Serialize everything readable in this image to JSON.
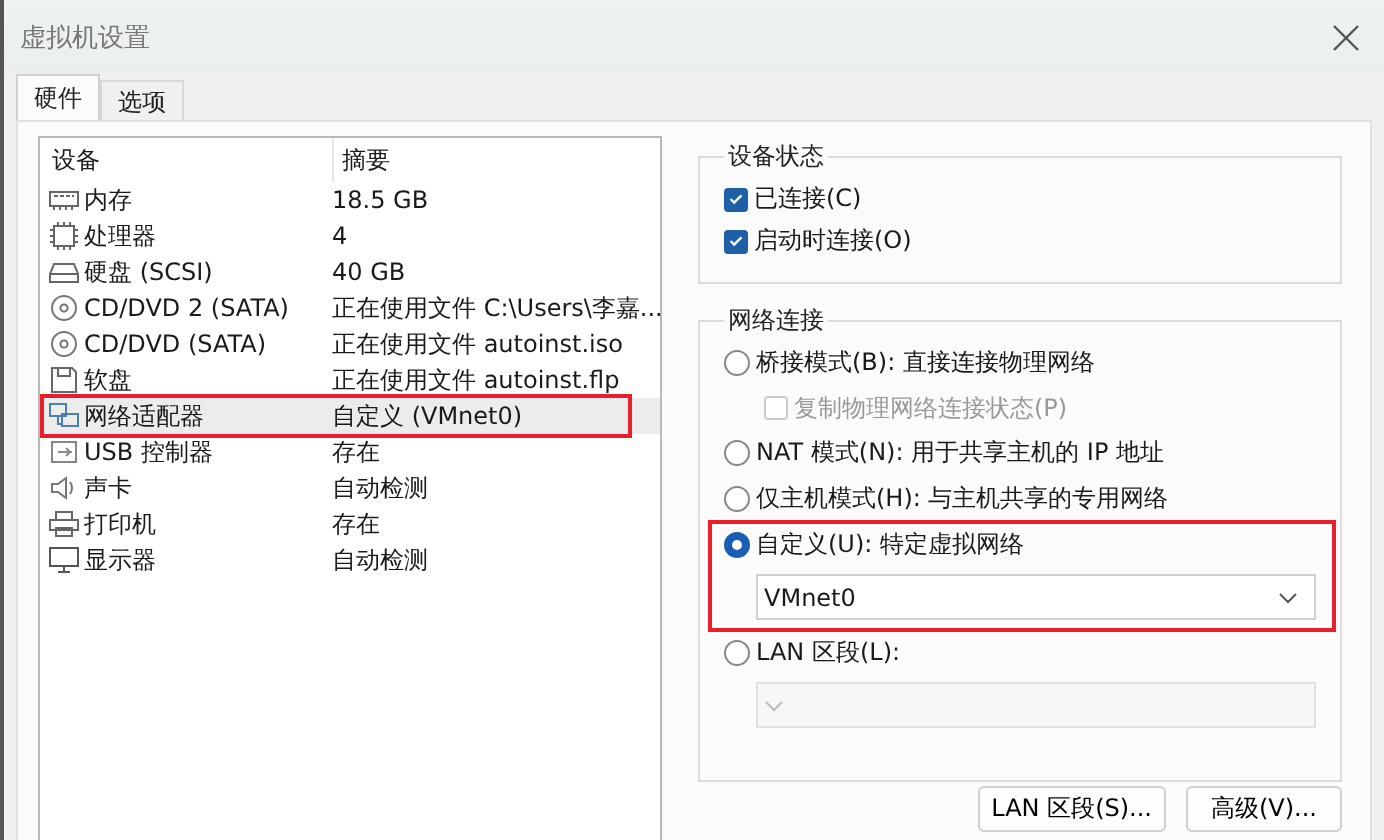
{
  "window": {
    "title": "虚拟机设置"
  },
  "tabs": [
    {
      "label": "硬件",
      "selected": true
    },
    {
      "label": "选项",
      "selected": false
    }
  ],
  "device_list": {
    "columns": [
      "设备",
      "摘要"
    ],
    "rows": [
      {
        "kind": "memory",
        "device": "内存",
        "summary": "18.5 GB",
        "selected": false,
        "highlighted": false
      },
      {
        "kind": "cpu",
        "device": "处理器",
        "summary": "4",
        "selected": false,
        "highlighted": false
      },
      {
        "kind": "disk",
        "device": "硬盘 (SCSI)",
        "summary": "40 GB",
        "selected": false,
        "highlighted": false
      },
      {
        "kind": "cd",
        "device": "CD/DVD 2 (SATA)",
        "summary": "正在使用文件 C:\\Users\\李嘉...",
        "selected": false,
        "highlighted": false
      },
      {
        "kind": "cd",
        "device": "CD/DVD (SATA)",
        "summary": "正在使用文件 autoinst.iso",
        "selected": false,
        "highlighted": false
      },
      {
        "kind": "floppy",
        "device": "软盘",
        "summary": "正在使用文件 autoinst.flp",
        "selected": false,
        "highlighted": false
      },
      {
        "kind": "network",
        "device": "网络适配器",
        "summary": "自定义 (VMnet0)",
        "selected": true,
        "highlighted": true
      },
      {
        "kind": "usb",
        "device": "USB 控制器",
        "summary": "存在",
        "selected": false,
        "highlighted": false
      },
      {
        "kind": "sound",
        "device": "声卡",
        "summary": "自动检测",
        "selected": false,
        "highlighted": false
      },
      {
        "kind": "printer",
        "device": "打印机",
        "summary": "存在",
        "selected": false,
        "highlighted": false
      },
      {
        "kind": "display",
        "device": "显示器",
        "summary": "自动检测",
        "selected": false,
        "highlighted": false
      }
    ]
  },
  "device_status": {
    "title": "设备状态",
    "options": [
      {
        "label": "已连接(C)",
        "checked": true
      },
      {
        "label": "启动时连接(O)",
        "checked": true
      }
    ]
  },
  "network_connection": {
    "title": "网络连接",
    "options": [
      {
        "kind": "radio",
        "label": "桥接模式(B): 直接连接物理网络",
        "selected": false,
        "highlighted": false
      },
      {
        "kind": "checkbox",
        "label": "复制物理网络连接状态(P)",
        "checked": false,
        "disabled": true
      },
      {
        "kind": "radio",
        "label": "NAT 模式(N): 用于共享主机的 IP 地址",
        "selected": false,
        "highlighted": false
      },
      {
        "kind": "radio",
        "label": "仅主机模式(H): 与主机共享的专用网络",
        "selected": false,
        "highlighted": false
      },
      {
        "kind": "radio",
        "label": "自定义(U): 特定虚拟网络",
        "selected": true,
        "highlighted": true,
        "dropdown": {
          "value": "VMnet0",
          "disabled": false
        }
      },
      {
        "kind": "radio",
        "label": "LAN 区段(L):",
        "selected": false,
        "highlighted": false,
        "dropdown": {
          "disabled": true
        }
      }
    ]
  },
  "buttons": [
    "LAN 区段(S)...",
    "高级(V)..."
  ]
}
